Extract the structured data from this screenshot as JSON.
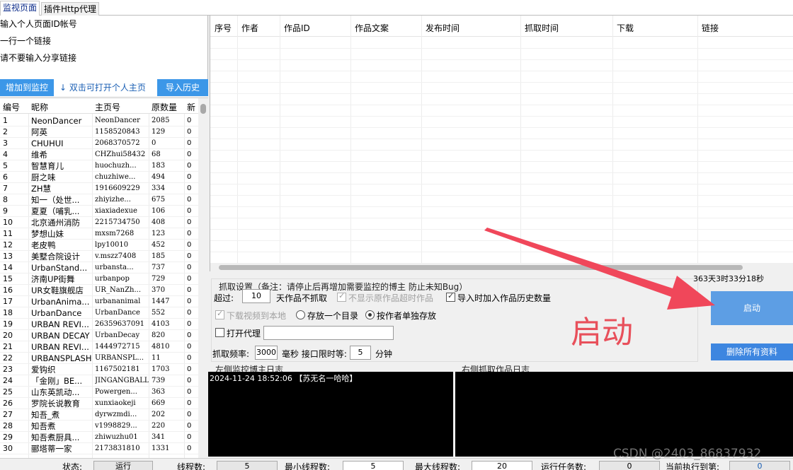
{
  "tabs": [
    {
      "label": "监视页面",
      "active": true
    },
    {
      "label": "插件Http代理",
      "active": false
    }
  ],
  "left": {
    "instructions": [
      "输入个人页面ID帐号",
      "一行一个链接",
      "请不要输入分享链接"
    ],
    "add_button": "增加到监控",
    "hint": "↓ 双击可打开个人主页",
    "import_button": "导入历史",
    "columns": [
      "编号",
      "昵称",
      "主页号",
      "原数量",
      "新"
    ],
    "rows": [
      [
        "1",
        "NeonDancer",
        "NeonDancer",
        "2085",
        "0"
      ],
      [
        "2",
        "阿英",
        "1158520843",
        "129",
        "0"
      ],
      [
        "3",
        "CHUHUI",
        "2068370572",
        "0",
        "0"
      ],
      [
        "4",
        "维希",
        "CHZhui58432",
        "68",
        "0"
      ],
      [
        "5",
        "智慧育儿",
        "huochuzh...",
        "183",
        "0"
      ],
      [
        "6",
        "厨之味",
        "chuzhiwe...",
        "494",
        "0"
      ],
      [
        "7",
        "ZH慧",
        "1916609229",
        "334",
        "0"
      ],
      [
        "8",
        "知一（处世...",
        "zhiyizhe...",
        "675",
        "0"
      ],
      [
        "9",
        "夏夏（哺乳...",
        "xiaxiadexue",
        "106",
        "0"
      ],
      [
        "10",
        "北京通州消防",
        "2215734750",
        "408",
        "0"
      ],
      [
        "11",
        "梦想山妹",
        "mxsm7268",
        "123",
        "0"
      ],
      [
        "12",
        "老皮鸭",
        "lpy10010",
        "452",
        "0"
      ],
      [
        "13",
        "美墅合院设计",
        "v.mszz7408",
        "185",
        "0"
      ],
      [
        "14",
        "UrbanStand...",
        "urbansta...",
        "737",
        "0"
      ],
      [
        "15",
        "济南UP街舞",
        "urbanpop",
        "729",
        "0"
      ],
      [
        "16",
        "UR女鞋旗舰店",
        "UR_NanZh...",
        "370",
        "0"
      ],
      [
        "17",
        "UrbanAnima...",
        "urbananimal",
        "1447",
        "0"
      ],
      [
        "18",
        "UrbanDance",
        "UrbanDance",
        "552",
        "0"
      ],
      [
        "19",
        "URBAN REVI...",
        "26359637091",
        "4103",
        "0"
      ],
      [
        "20",
        "URBAN DECAY",
        "UrbanDecay",
        "820",
        "0"
      ],
      [
        "21",
        "URBAN REVI...",
        "1444972715",
        "4810",
        "0"
      ],
      [
        "22",
        "URBANSPLASHc",
        "URBANSPL...",
        "11",
        "0"
      ],
      [
        "23",
        "爱钩织",
        "1167502181",
        "1703",
        "0"
      ],
      [
        "24",
        "「金刚」BE...",
        "JINGANGBALL",
        "739",
        "0"
      ],
      [
        "25",
        "山东英凯动...",
        "Powergen...",
        "363",
        "0"
      ],
      [
        "26",
        "罗院长说教育",
        "xunxiaokeji",
        "669",
        "0"
      ],
      [
        "27",
        "知吾_煮",
        "dyrwzmdi...",
        "202",
        "0"
      ],
      [
        "28",
        "知吾煮",
        "v1998829...",
        "220",
        "0"
      ],
      [
        "29",
        "知吾煮厨具...",
        "zhiwuzhu01",
        "341",
        "0"
      ],
      [
        "30",
        "郦塔蒂一家",
        "2173831810",
        "1331",
        "0"
      ]
    ]
  },
  "grid": {
    "columns": [
      "序号",
      "作者",
      "作品ID",
      "作品文案",
      "发布时间",
      "抓取时间",
      "下载",
      "链接"
    ]
  },
  "settings": {
    "group_title": "抓取设置（备注：请停止后再增加需要监控的博主 防止未知Bug）",
    "timer": "363天3时33分18秒",
    "days_label": "超过:",
    "days_value": "10",
    "days_suffix": "天作品不抓取",
    "hide_original": "不显示原作品超时作品",
    "import_history": "导入时加入作品历史数量",
    "download_local": "下载视频到本地",
    "same_dir": "存放一个目录",
    "per_author": "按作者单独存放",
    "proxy_label": "打开代理",
    "proxy_value": "",
    "freq_label": "抓取频率:",
    "freq_value": "3000",
    "ms_label": "毫秒 接口限时等:",
    "wait_value": "5",
    "minute_label": "分钟",
    "start_button": "启动",
    "delete_button": "删除所有资料"
  },
  "logs": {
    "left_title": "左侧监控博主日志",
    "right_title": "右侧抓取作品日志",
    "left_entry": "2024-11-24 18:52:06  【苏无名一哈哈】"
  },
  "status": {
    "state_label": "状态:",
    "state_value": "运行",
    "threads_label": "线程数:",
    "threads_value": "5",
    "min_threads_label": "最小线程数:",
    "min_threads_value": "5",
    "max_threads_label": "最大线程数:",
    "max_threads_value": "20",
    "tasks_label": "运行任务数:",
    "tasks_value": "0",
    "current_label": "当前执行到第:",
    "current_value": "0"
  },
  "overlay": {
    "annotation": "启动",
    "watermark": "CSDN @2403_86837932",
    "arrow_color": "#f0475a"
  }
}
